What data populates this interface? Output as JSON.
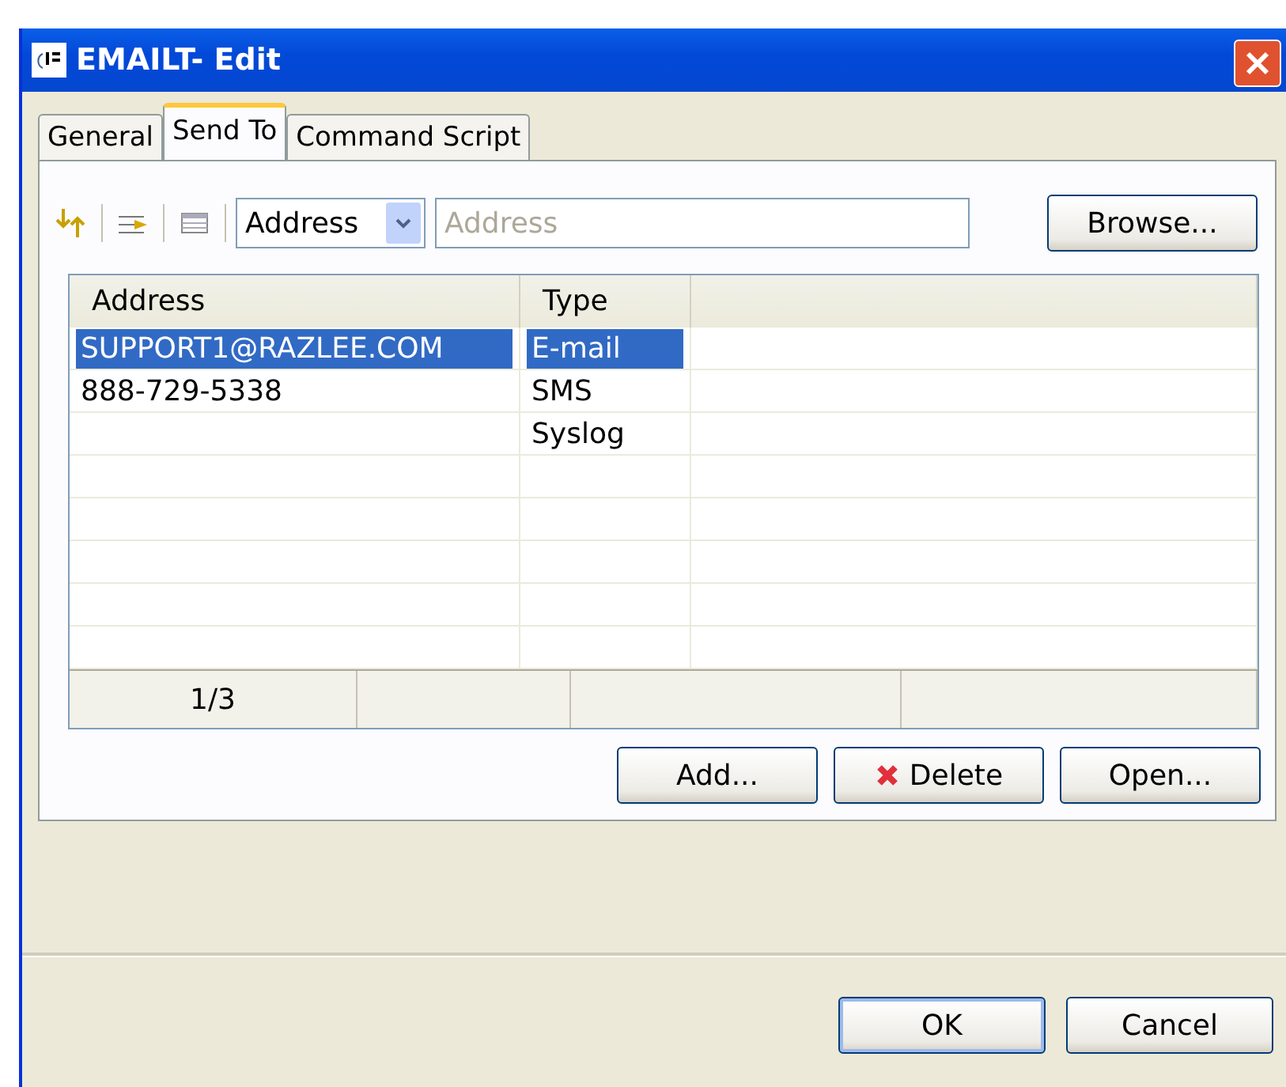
{
  "window": {
    "title": "EMAILT- Edit"
  },
  "tabs": [
    {
      "label": "General",
      "selected": false
    },
    {
      "label": "Send To",
      "selected": true
    },
    {
      "label": "Command Script",
      "selected": false
    }
  ],
  "toolbar": {
    "dropdown": {
      "value": "Address"
    },
    "search": {
      "placeholder": "Address"
    },
    "browse_button": "Browse..."
  },
  "table": {
    "columns": [
      "Address",
      "Type"
    ],
    "rows": [
      {
        "cells": [
          "SUPPORT1@RAZLEE.COM",
          "E-mail"
        ],
        "selected": true
      },
      {
        "cells": [
          "888-729-5338",
          "SMS"
        ],
        "selected": false
      },
      {
        "cells": [
          "",
          "Syslog"
        ],
        "selected": false
      }
    ],
    "status_bar": [
      "1/3"
    ]
  },
  "list_buttons": [
    {
      "label": "Add...",
      "kind": "plain"
    },
    {
      "label": "Delete",
      "kind": "delete"
    },
    {
      "label": "Open...",
      "kind": "plain"
    }
  ],
  "dialog_buttons": [
    {
      "label": "OK",
      "kind": "default"
    },
    {
      "label": "Cancel",
      "kind": "plain"
    }
  ]
}
